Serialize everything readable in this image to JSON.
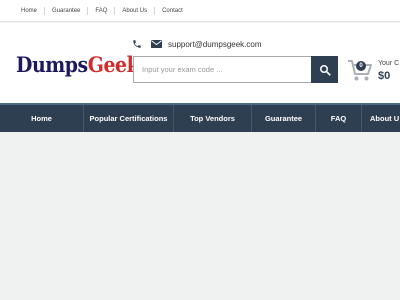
{
  "topbar": {
    "links": [
      "Home",
      "Guarantee",
      "FAQ",
      "About Us",
      "Contact"
    ]
  },
  "header": {
    "logo_main": "Dumps",
    "logo_accent": "Geek",
    "email": "support@dumpsgeek.com",
    "search_placeholder": "Input your exam code ...",
    "cart_count": "0",
    "cart_label": "Your C",
    "cart_total": "$0"
  },
  "nav": {
    "items": [
      "Home",
      "Popular Certifications",
      "Top Vendors",
      "Guarantee",
      "FAQ",
      "About U"
    ]
  },
  "colors": {
    "nav_bg": "#2f3f52",
    "logo_primary": "#1c1a5e",
    "logo_accent": "#d12c2c",
    "page_bg": "#f0f1f1"
  },
  "icons": [
    "phone-icon",
    "mail-icon",
    "search-icon",
    "cart-icon"
  ]
}
